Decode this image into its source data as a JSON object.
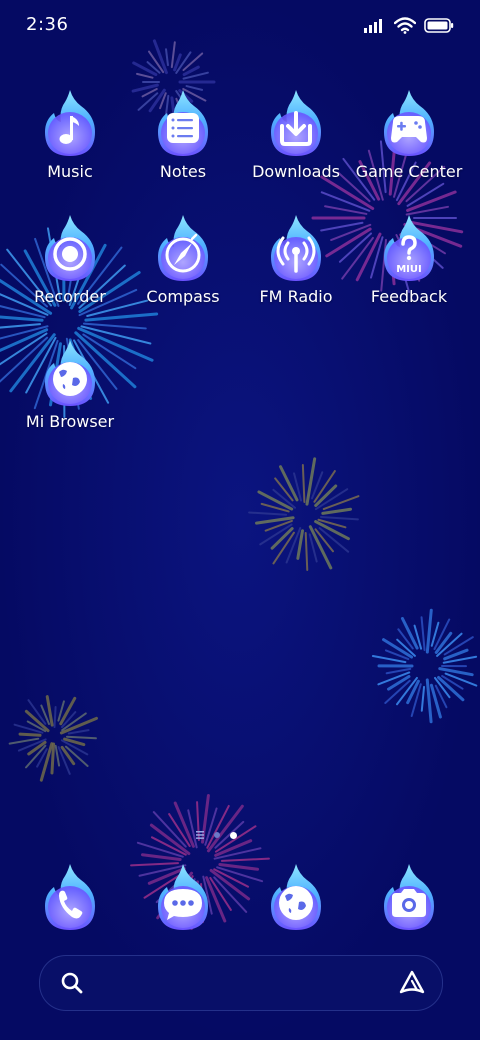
{
  "status_bar": {
    "time": "2:36",
    "icons": [
      "signal-icon",
      "wifi-icon",
      "battery-icon"
    ]
  },
  "apps": [
    {
      "label": "Music",
      "icon": "music-note-icon"
    },
    {
      "label": "Notes",
      "icon": "notes-list-icon"
    },
    {
      "label": "Downloads",
      "icon": "download-icon"
    },
    {
      "label": "Game Center",
      "icon": "gamepad-icon"
    },
    {
      "label": "Recorder",
      "icon": "record-icon"
    },
    {
      "label": "Compass",
      "icon": "compass-icon"
    },
    {
      "label": "FM Radio",
      "icon": "radio-icon"
    },
    {
      "label": "Feedback",
      "icon": "feedback-miui-icon",
      "badge": "MIUI"
    },
    {
      "label": "Mi Browser",
      "icon": "browser-globe-icon"
    }
  ],
  "page_indicator": {
    "pages": 3,
    "active": 3
  },
  "dock": [
    {
      "icon": "phone-icon"
    },
    {
      "icon": "messages-icon"
    },
    {
      "icon": "browser-globe-icon"
    },
    {
      "icon": "camera-icon"
    }
  ],
  "search_bar": {
    "icon": "search-icon",
    "assistant_icon": "assistant-icon"
  },
  "colors": {
    "background": "#050a63",
    "flame_light": "#7ad8ff",
    "flame_mid": "#5aa2ff",
    "flame_dark": "#7b4dff"
  }
}
